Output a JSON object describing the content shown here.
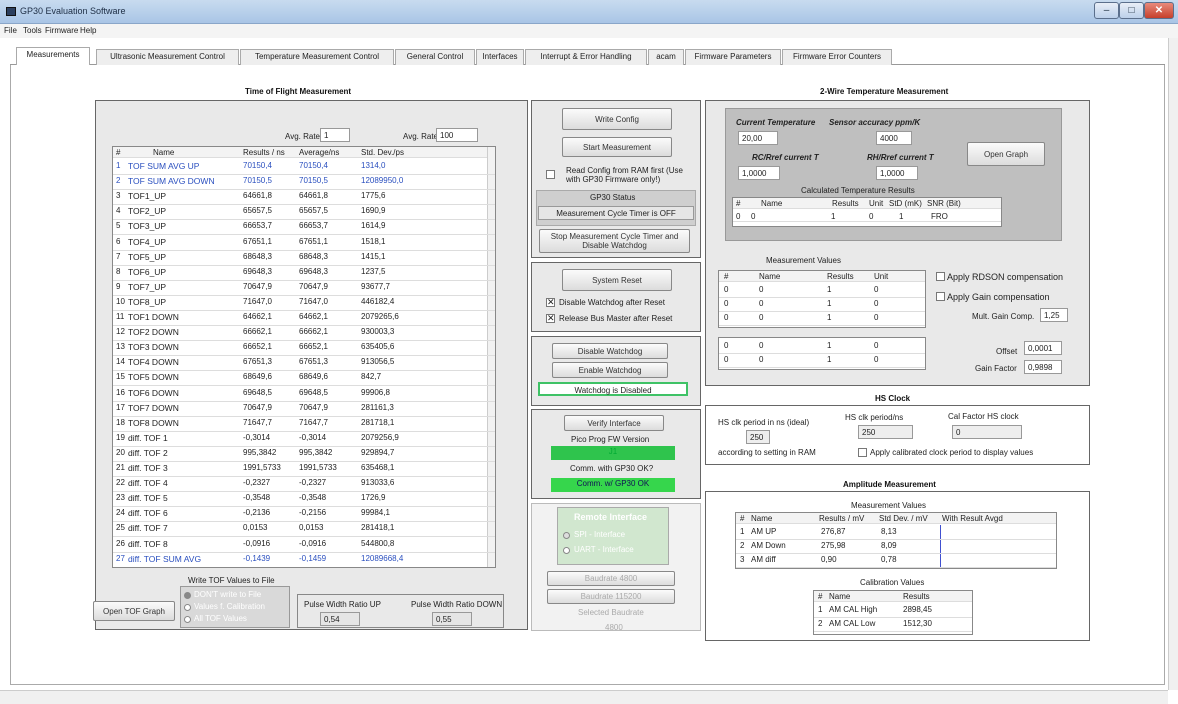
{
  "window": {
    "title": "GP30 Evaluation Software"
  },
  "menu": [
    "File",
    "Tools",
    "Firmware",
    "Help"
  ],
  "tabs": [
    "Measurements",
    "Ultrasonic Measurement Control",
    "Temperature Measurement Control",
    "General Control",
    "Interfaces",
    "Interrupt & Error Handling",
    "acam",
    "Firmware Parameters",
    "Firmware Error Counters"
  ],
  "tof": {
    "title": "Time of Flight Measurement",
    "avg_rate_label": "Avg. Rate:",
    "avg_rate_1": "1",
    "avg_rate_2": "100",
    "headers": [
      "#",
      "Name",
      "Results / ns",
      "Average/ns",
      "Std. Dev./ps"
    ],
    "rows": [
      [
        "1",
        "TOF SUM AVG UP",
        "70150,4",
        "70150,4",
        "1314,0"
      ],
      [
        "2",
        "TOF SUM AVG DOWN",
        "70150,5",
        "70150,5",
        "12089950,0"
      ],
      [
        "3",
        "TOF1_UP",
        "64661,8",
        "64661,8",
        "1775,6"
      ],
      [
        "4",
        "TOF2_UP",
        "65657,5",
        "65657,5",
        "1690,9"
      ],
      [
        "5",
        "TOF3_UP",
        "66653,7",
        "66653,7",
        "1614,9"
      ],
      [
        "6",
        "TOF4_UP",
        "67651,1",
        "67651,1",
        "1518,1"
      ],
      [
        "7",
        "TOF5_UP",
        "68648,3",
        "68648,3",
        "1415,1"
      ],
      [
        "8",
        "TOF6_UP",
        "69648,3",
        "69648,3",
        "1237,5"
      ],
      [
        "9",
        "TOF7_UP",
        "70647,9",
        "70647,9",
        "93677,7"
      ],
      [
        "10",
        "TOF8_UP",
        "71647,0",
        "71647,0",
        "446182,4"
      ],
      [
        "11",
        "TOF1 DOWN",
        "64662,1",
        "64662,1",
        "2079265,6"
      ],
      [
        "12",
        "TOF2 DOWN",
        "66662,1",
        "66662,1",
        "930003,3"
      ],
      [
        "13",
        "TOF3 DOWN",
        "66652,1",
        "66652,1",
        "635405,6"
      ],
      [
        "14",
        "TOF4 DOWN",
        "67651,3",
        "67651,3",
        "913056,5"
      ],
      [
        "15",
        "TOF5 DOWN",
        "68649,6",
        "68649,6",
        "842,7"
      ],
      [
        "16",
        "TOF6 DOWN",
        "69648,5",
        "69648,5",
        "99906,8"
      ],
      [
        "17",
        "TOF7 DOWN",
        "70647,9",
        "70647,9",
        "281161,3"
      ],
      [
        "18",
        "TOF8 DOWN",
        "71647,7",
        "71647,7",
        "281718,1"
      ],
      [
        "19",
        "diff. TOF 1",
        "-0,3014",
        "-0,3014",
        "2079256,9"
      ],
      [
        "20",
        "diff. TOF 2",
        "995,3842",
        "995,3842",
        "929894,7"
      ],
      [
        "21",
        "diff. TOF 3",
        "1991,5733",
        "1991,5733",
        "635468,1"
      ],
      [
        "22",
        "diff. TOF 4",
        "-0,2327",
        "-0,2327",
        "913033,6"
      ],
      [
        "23",
        "diff. TOF 5",
        "-0,3548",
        "-0,3548",
        "1726,9"
      ],
      [
        "24",
        "diff. TOF 6",
        "-0,2136",
        "-0,2156",
        "99984,1"
      ],
      [
        "25",
        "diff. TOF 7",
        "0,0153",
        "0,0153",
        "281418,1"
      ],
      [
        "26",
        "diff. TOF 8",
        "-0,0916",
        "-0,0916",
        "544800,8"
      ],
      [
        "27",
        "diff. TOF SUM AVG",
        "-0,1439",
        "-0,1459",
        "12089668,4"
      ]
    ],
    "write_label": "Write TOF Values to File",
    "radio": [
      "DON'T write to File",
      "Values f. Calibration",
      "All TOF Values"
    ],
    "open_graph": "Open TOF Graph",
    "pw_up_label": "Pulse Width Ratio UP",
    "pw_up": "0,54",
    "pw_down_label": "Pulse Width Ratio DOWN",
    "pw_down": "0,55"
  },
  "mid": {
    "write_config": "Write Config",
    "start": "Start Measurement",
    "read_config": "Read Config from RAM first (Use with GP30 Firmware only!)",
    "status_title": "GP30 Status",
    "status_text": "Measurement Cycle Timer is OFF",
    "stop": "Stop Measurement Cycle Timer and Disable Watchdog",
    "reset": "System Reset",
    "cb1": "Disable Watchdog after Reset",
    "cb2": "Release Bus Master after Reset",
    "disable_wd": "Disable Watchdog",
    "enable_wd": "Enable Watchdog",
    "wd_status": "Watchdog is Disabled",
    "verify": "Verify Interface",
    "pico_label": "Pico Prog FW Version",
    "pico_value": "J1",
    "comm_label": "Comm. with GP30 OK?",
    "comm_value": "Comm. w/ GP30 OK",
    "remote": "Remote Interface",
    "spi": "SPI - Interface",
    "uart": "UART - Interface",
    "baud1": "Baudrate 4800",
    "baud2": "Baudrate 115200",
    "sel_baud_label": "Selected Baudrate",
    "sel_baud": "4800"
  },
  "temp": {
    "title": "2-Wire Temperature Measurement",
    "cur_label": "Current Temperature",
    "cur": "20,00",
    "acc_label": "Sensor accuracy ppm/K",
    "acc": "4000",
    "rc_label": "RC/Rref current T",
    "rc": "1,0000",
    "rh_label": "RH/Rref current T",
    "rh": "1,0000",
    "open_graph": "Open Graph",
    "calc_title": "Calculated Temperature Results",
    "calc_headers": [
      "#",
      "Name",
      "Results",
      "Unit",
      "StD (mK)",
      "SNR (Bit)"
    ],
    "calc_row": [
      "0",
      "0",
      "1",
      "0",
      "1",
      "FRO"
    ],
    "mv_title": "Measurement Values",
    "mv_headers": [
      "#",
      "Name",
      "Results",
      "Unit"
    ],
    "mv_rows": [
      [
        "0",
        "0",
        "1",
        "0"
      ],
      [
        "0",
        "0",
        "1",
        "0"
      ],
      [
        "0",
        "0",
        "1",
        "0"
      ]
    ],
    "mv2_rows": [
      [
        "0",
        "0",
        "1",
        "0"
      ],
      [
        "0",
        "0",
        "1",
        "0"
      ]
    ],
    "rdson": "Apply RDSON compensation",
    "gain": "Apply Gain compensation",
    "mult_label": "Mult. Gain Comp.",
    "mult": "1,25",
    "offset_label": "Offset",
    "offset": "0,0001",
    "gf_label": "Gain Factor",
    "gf": "0,9898"
  },
  "hs": {
    "title": "HS Clock",
    "ideal_label": "HS clk period in ns (ideal)",
    "ideal": "250",
    "ram_label": "according to setting in RAM",
    "period_label": "HS clk period/ns",
    "period": "250",
    "cal_label": "Cal Factor HS clock",
    "cal": "0",
    "apply": "Apply calibrated clock period to display values"
  },
  "amp": {
    "title": "Amplitude Measurement",
    "mv_title": "Measurement Values",
    "headers": [
      "#",
      "Name",
      "Results / mV",
      "Std Dev. / mV",
      "With Result Avgd"
    ],
    "rows": [
      [
        "1",
        "AM UP",
        "276,87",
        "8,13"
      ],
      [
        "2",
        "AM Down",
        "275,98",
        "8,09"
      ],
      [
        "3",
        "AM diff",
        "0,90",
        "0,78"
      ]
    ],
    "cal_title": "Calibration Values",
    "cal_headers": [
      "#",
      "Name",
      "Results"
    ],
    "cal_rows": [
      [
        "1",
        "AM CAL High",
        "2898,45"
      ],
      [
        "2",
        "AM CAL Low",
        "1512,30"
      ]
    ]
  }
}
